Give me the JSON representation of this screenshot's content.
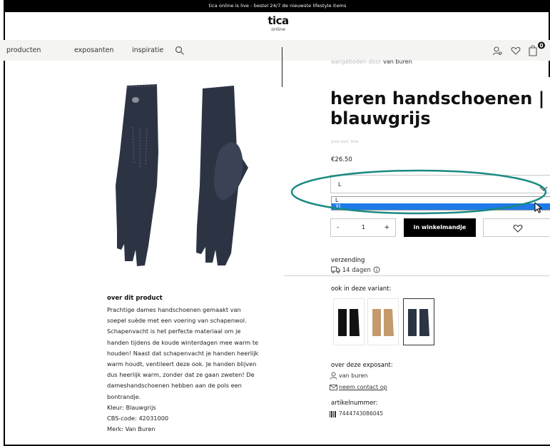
{
  "announcement": "tica online is live - bestel 24/7 de nieuwste lifestyle items",
  "brand": {
    "name": "tica",
    "sub": "online"
  },
  "nav": {
    "items": [
      "producten",
      "exposanten",
      "inspiratie"
    ],
    "cart_count": "0"
  },
  "product": {
    "offered_by_prefix": "aangeboden door",
    "offered_by_name": "van buren",
    "title_line1": "heren handschoenen |",
    "title_line2": "blauwgrijs",
    "vat_note": "prijs excl. btw",
    "price": "€26.50"
  },
  "size_select": {
    "value": "L",
    "options": [
      "L",
      "XL"
    ],
    "highlighted": "XL"
  },
  "quantity": {
    "minus": "-",
    "value": "1",
    "plus": "+"
  },
  "cart_button": "in winkelmandje",
  "shipping": {
    "label": "verzending",
    "days": "14 dagen"
  },
  "variants": {
    "label": "ook in deze variant:",
    "colors": [
      "#121212",
      "#c49a6c",
      "#2c3444"
    ],
    "selected_index": 2
  },
  "exhibitor": {
    "label": "over deze exposant:",
    "name": "van buren",
    "contact": "neem contact op"
  },
  "article": {
    "label": "artikelnummer:",
    "number": "7444743086045"
  },
  "about": {
    "heading": "over dit product",
    "lines": [
      "Prachtige dames handschoenen gemaakt van",
      "soepel suède met een voering van schapenwol.",
      "Schapenvacht is het perfecte materiaal om je",
      "handen tijdens de koude winterdagen mee warm te",
      "houden! Naast dat schapenvacht je handen heerlijk",
      "warm houdt, ventileert deze ook. Je handen blijven",
      "dus heerlijk warm, zonder dat ze gaan zweten! De",
      "dameshandschoenen hebben aan de pols een",
      "bontrandje.",
      "Kleur: Blauwgrijs",
      "CBS-code: 42031000",
      "Merk: Van Buren"
    ]
  },
  "colors": {
    "glove": "#2c3444",
    "highlight": "#1a8a82",
    "selected_option": "#1e7ae8"
  }
}
